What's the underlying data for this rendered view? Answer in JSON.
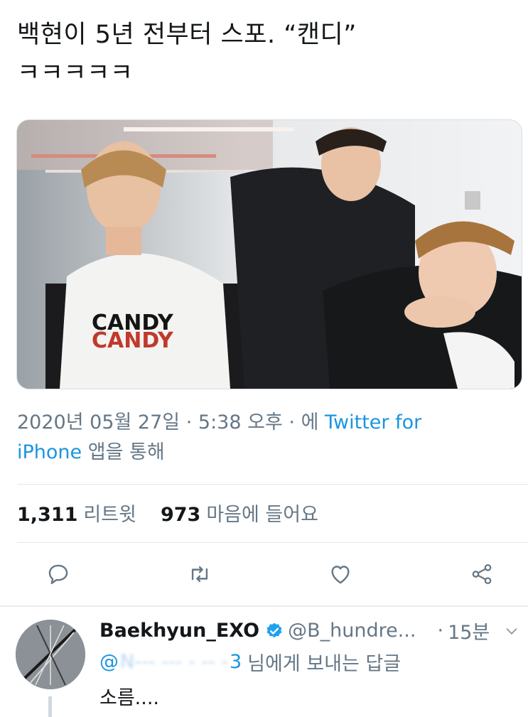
{
  "tweet": {
    "text_line1": "백현이 5년 전부터 스포. “캔디”",
    "text_line2": "ㅋㅋㅋㅋㅋ",
    "image_alt": "three men in black jackets, one wearing a white 'CANDY' t-shirt",
    "shirt_text": "CANDY"
  },
  "meta": {
    "date": "2020년 05월 27일",
    "sep1": "·",
    "time": "5:38 오후",
    "sep2": "·",
    "via_prefix": "에",
    "source_part1": "Twitter for",
    "source_part2": "iPhone",
    "via_suffix": "앱을 통해"
  },
  "stats": {
    "retweets_count": "1,311",
    "retweets_label": "리트윗",
    "likes_count": "973",
    "likes_label": "마음에 들어요"
  },
  "actions": [
    "reply-icon",
    "retweet-icon",
    "like-icon",
    "share-icon"
  ],
  "reply": {
    "name": "Baekhyun_EXO",
    "handle": "@B_hundre...",
    "time": "15분",
    "dot": "·",
    "mention_start": "@",
    "mention_hidden": "N---  --- -  -- -",
    "mention_end": "3",
    "reply_label": "님에게 보내는 답글",
    "text": "소름...."
  },
  "colors": {
    "link": "#1b95e0",
    "secondary": "#657786",
    "primary_text": "#14171a",
    "divider": "#e1e8ed"
  }
}
